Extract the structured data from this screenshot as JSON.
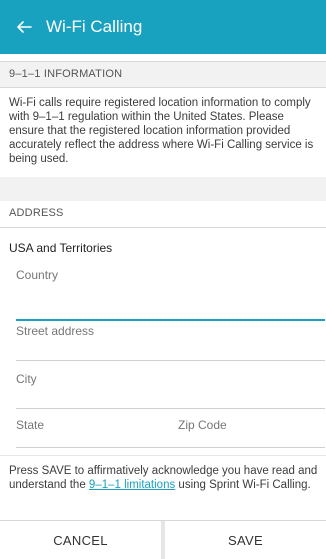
{
  "appbar": {
    "title": "Wi-Fi Calling",
    "back_icon": "arrow-left-icon",
    "color": "#18a2bf"
  },
  "info_section": {
    "header": "9–1–1 INFORMATION",
    "text": "Wi-Fi calls require registered location information to comply with 9–1–1 regulation within the United States. Please ensure that the registered location information provided accurately reflect the address where Wi-Fi Calling service is being used."
  },
  "address_section": {
    "header": "ADDRESS",
    "region": "USA and Territories",
    "fields": {
      "country": "Country",
      "street": "Street address",
      "city": "City",
      "state": "State",
      "zip": "Zip Code"
    }
  },
  "note": {
    "before": "Press SAVE to affirmatively acknowledge you have read and understand the ",
    "link": "9–1–1 limitations",
    "after": " using Sprint Wi-Fi Calling."
  },
  "actions": {
    "cancel": "CANCEL",
    "save": "SAVE"
  }
}
